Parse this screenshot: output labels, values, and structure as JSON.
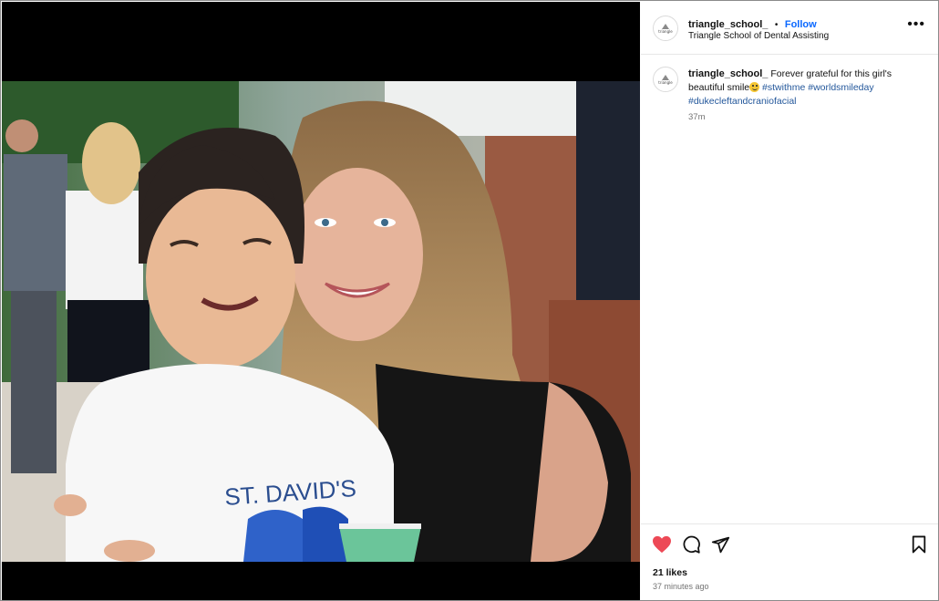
{
  "post": {
    "username": "triangle_school_",
    "separator": "•",
    "follow_label": "Follow",
    "subtitle": "Triangle School of Dental Assisting",
    "avatar_text": "triangle",
    "more_icon": "more-horizontal-icon",
    "caption": {
      "username": "triangle_school_",
      "text": "Forever grateful for this girl's beautiful smile",
      "emoji": "grinning-face-emoji",
      "hashtags": [
        "#stwithme",
        "#worldsmileday",
        "#dukecleftandcraniofacial"
      ],
      "time": "37m"
    },
    "actions": {
      "like_icon": "heart-filled-icon",
      "comment_icon": "comment-icon",
      "share_icon": "send-icon",
      "save_icon": "bookmark-icon"
    },
    "likes": "21 likes",
    "posted": "37 minutes ago",
    "shirt_text": "ST. DAVID'S",
    "colors": {
      "like": "#ed4956",
      "link": "#0a68ff",
      "hashtag": "#23579b"
    }
  }
}
